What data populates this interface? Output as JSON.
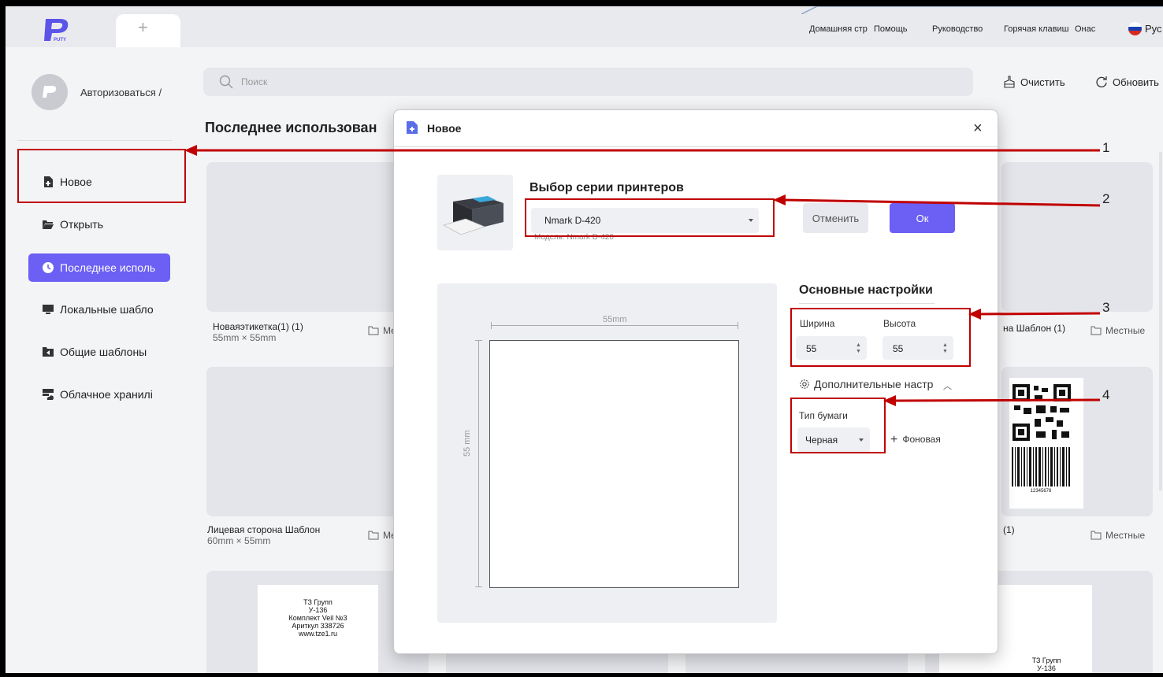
{
  "topbar": {
    "logo_text": "PUTY",
    "new_tab_symbol": "+",
    "nav": [
      "Домашняя стра",
      "Помощь",
      "Руководство",
      "Горячая клавиш",
      "Онас"
    ],
    "language": "Рус"
  },
  "sidebar": {
    "login": "Авторизоваться /",
    "items": [
      {
        "label": "Новое",
        "icon": "new-file-icon",
        "active": false
      },
      {
        "label": "Открыть",
        "icon": "folder-open-icon",
        "active": false
      },
      {
        "label": "Последнее исполь",
        "icon": "clock-icon",
        "active": true
      },
      {
        "label": "Локальные шабло",
        "icon": "monitor-icon",
        "active": false
      },
      {
        "label": "Общие шаблоны",
        "icon": "share-folder-icon",
        "active": false
      },
      {
        "label": "Облачное хранилі",
        "icon": "cloud-storage-icon",
        "active": false
      }
    ]
  },
  "main": {
    "search_placeholder": "Поиск",
    "clear_label": "Очистить",
    "refresh_label": "Обновить",
    "section_title": "Последнее использован",
    "cards": [
      {
        "name": "Новаяэтикетка(1) (1)",
        "size": "55mm × 55mm",
        "location": "Ме"
      },
      {
        "name": "на Шаблон (1)",
        "location": "Местные"
      },
      {
        "name": "Лицевая сторона Шаблон",
        "size": "60mm × 55mm",
        "location": "Ме"
      },
      {
        "name": "(1)",
        "location": "Местные"
      }
    ],
    "label_preview_lines": [
      "ТЗ Групп",
      "У-136",
      "Комплект Veil №3",
      "Ариткул 338726",
      "www.tze1.ru"
    ],
    "label_preview_lines_right": [
      "ТЗ Групп",
      "У-136"
    ],
    "barcode_number": "12345678"
  },
  "dialog": {
    "title": "Новое",
    "printer_series_title": "Выбор серии принтеров",
    "printer_selected": "Nmark D-420",
    "model_text": "Модель:  Nmark D-420",
    "cancel_label": "Отменить",
    "ok_label": "Ок",
    "preview_width_label": "55mm",
    "preview_height_label": "55 mm",
    "basic_settings_title": "Основные настройки",
    "width_label": "Ширина",
    "height_label": "Высота",
    "width_value": "55",
    "height_value": "55",
    "advanced_label": "Дополнительные настр",
    "paper_type_label": "Тип бумаги",
    "paper_type_value": "Черная",
    "background_label": "Фоновая"
  },
  "annotations": [
    "1",
    "2",
    "3",
    "4"
  ],
  "colors": {
    "accent": "#6b5ff4",
    "annotation": "#c00000"
  }
}
